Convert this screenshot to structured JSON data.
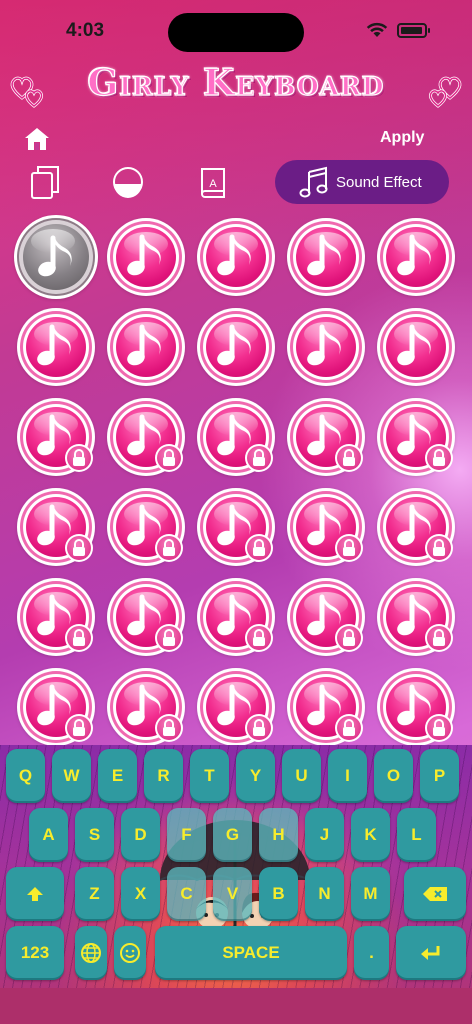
{
  "status_bar": {
    "time": "4:03"
  },
  "app": {
    "title": "Girly Keyboard"
  },
  "header": {
    "apply_label": "Apply"
  },
  "tools": {
    "sound_effect_label": "Sound Effect"
  },
  "sounds": {
    "selected_index": 0,
    "locked_from_index": 10,
    "count": 30
  },
  "keyboard": {
    "row1": [
      "Q",
      "W",
      "E",
      "R",
      "T",
      "Y",
      "U",
      "I",
      "O",
      "P"
    ],
    "row2": [
      "A",
      "S",
      "D",
      "F",
      "G",
      "H",
      "J",
      "K",
      "L"
    ],
    "row3": [
      "Z",
      "X",
      "C",
      "V",
      "B",
      "N",
      "M"
    ],
    "numbers_label": "123",
    "space_label": "SPACE",
    "period_label": ".",
    "key_color": "#2f9aa0",
    "key_text_color": "#f7ec2c"
  },
  "colors": {
    "accent": "#f22e8f",
    "pill": "#6b1d86"
  }
}
